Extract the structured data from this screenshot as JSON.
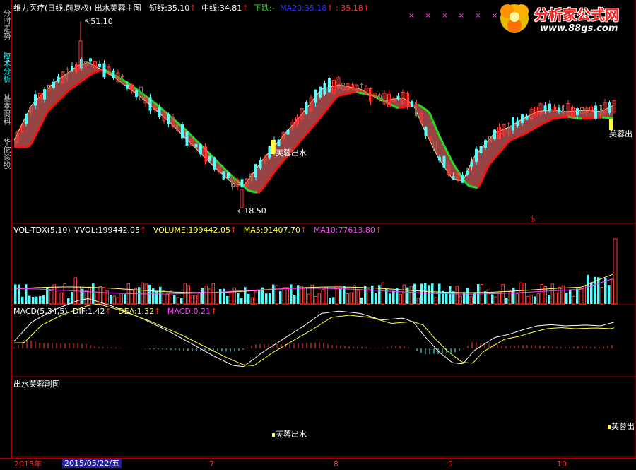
{
  "sidebar": {
    "tabs": [
      {
        "label": "分时走势",
        "active": false
      },
      {
        "label": "技术分析",
        "active": true
      },
      {
        "label": "基本资料",
        "active": false
      },
      {
        "label": "华佗诊股",
        "active": false
      }
    ]
  },
  "main": {
    "stock": "维力医疗(日线,前复权)",
    "indicator": "出水芙蓉主图",
    "short_label": "短线:",
    "short_value": "35.10",
    "mid_label": "中线:",
    "mid_value": "34.81",
    "down_label": "下跌:",
    "down_value": "-",
    "ma20_label": "MA20:",
    "ma20_value": "35.18",
    "extra_value": ": 35.18",
    "high_label": "51.10",
    "low_label": "18.50",
    "signal_label": "芙蓉出水",
    "signal_label_right": "芙蓉出",
    "dollar_mark": "$"
  },
  "volume": {
    "title": "VOL-TDX(5,10)",
    "vvol_label": "VVOL:",
    "vvol_value": "199442.05",
    "volume_label": "VOLUME:",
    "volume_value": "199442.05",
    "ma5_label": "MA5:",
    "ma5_value": "91407.70",
    "ma10_label": "MA10:",
    "ma10_value": "77613.80"
  },
  "macd": {
    "title": "MACD(5,34,5)",
    "dif_label": "DIF:",
    "dif_value": "1.42",
    "dea_label": "DEA:",
    "dea_value": "1.32",
    "macd_label": "MACD:",
    "macd_value": "0.21"
  },
  "sub": {
    "title": "出水芙蓉副图",
    "signal_label": "芙蓉出水",
    "signal_label_right": "芙蓉出"
  },
  "bottom": {
    "year": "2015年",
    "date": "2015/05/22/五",
    "months": [
      "7",
      "8",
      "9",
      "10"
    ]
  },
  "logo": {
    "name": "分析家公式网",
    "url": "www.88gs.com"
  },
  "colors": {
    "up": "#ff3c3c",
    "down": "#54ffff",
    "band": "#b05050",
    "red_line": "#ff1010",
    "green_line": "#20e020",
    "yellow": "#ffff40",
    "grid": "#a00000",
    "ma10": "#ff40ff"
  },
  "chart_data": [
    {
      "type": "candlestick",
      "title": "维力医疗(日线,前复权)",
      "annotations": [
        "51.10",
        "18.50",
        "芙蓉出水"
      ],
      "series": [
        {
          "name": "短线",
          "last": 35.1
        },
        {
          "name": "中线",
          "last": 34.81
        },
        {
          "name": "MA20",
          "last": 35.18
        }
      ]
    },
    {
      "type": "bar",
      "title": "VOL-TDX(5,10)",
      "series": [
        {
          "name": "VOLUME",
          "last": 199442.05
        },
        {
          "name": "MA5",
          "last": 91407.7
        },
        {
          "name": "MA10",
          "last": 77613.8
        }
      ]
    },
    {
      "type": "line",
      "title": "MACD(5,34,5)",
      "series": [
        {
          "name": "DIF",
          "last": 1.42
        },
        {
          "name": "DEA",
          "last": 1.32
        },
        {
          "name": "MACD",
          "last": 0.21
        }
      ]
    }
  ]
}
